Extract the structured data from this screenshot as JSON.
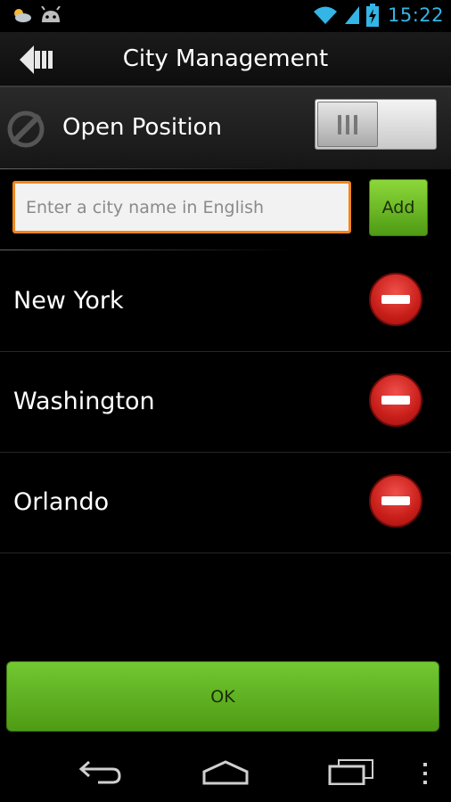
{
  "status_bar": {
    "time": "15:22"
  },
  "header": {
    "title": "City Management"
  },
  "location": {
    "label": "Open Position",
    "enabled": false
  },
  "city_input": {
    "placeholder": "Enter a city name in English",
    "value": ""
  },
  "add_button": {
    "label": "Add"
  },
  "cities": [
    {
      "name": "New York"
    },
    {
      "name": "Washington"
    },
    {
      "name": "Orlando"
    }
  ],
  "ok_button": {
    "label": "OK"
  },
  "colors": {
    "accent_orange": "#f0851d",
    "button_green": "#5fb322",
    "remove_red": "#d42a25",
    "clock_blue": "#33b5e5"
  }
}
